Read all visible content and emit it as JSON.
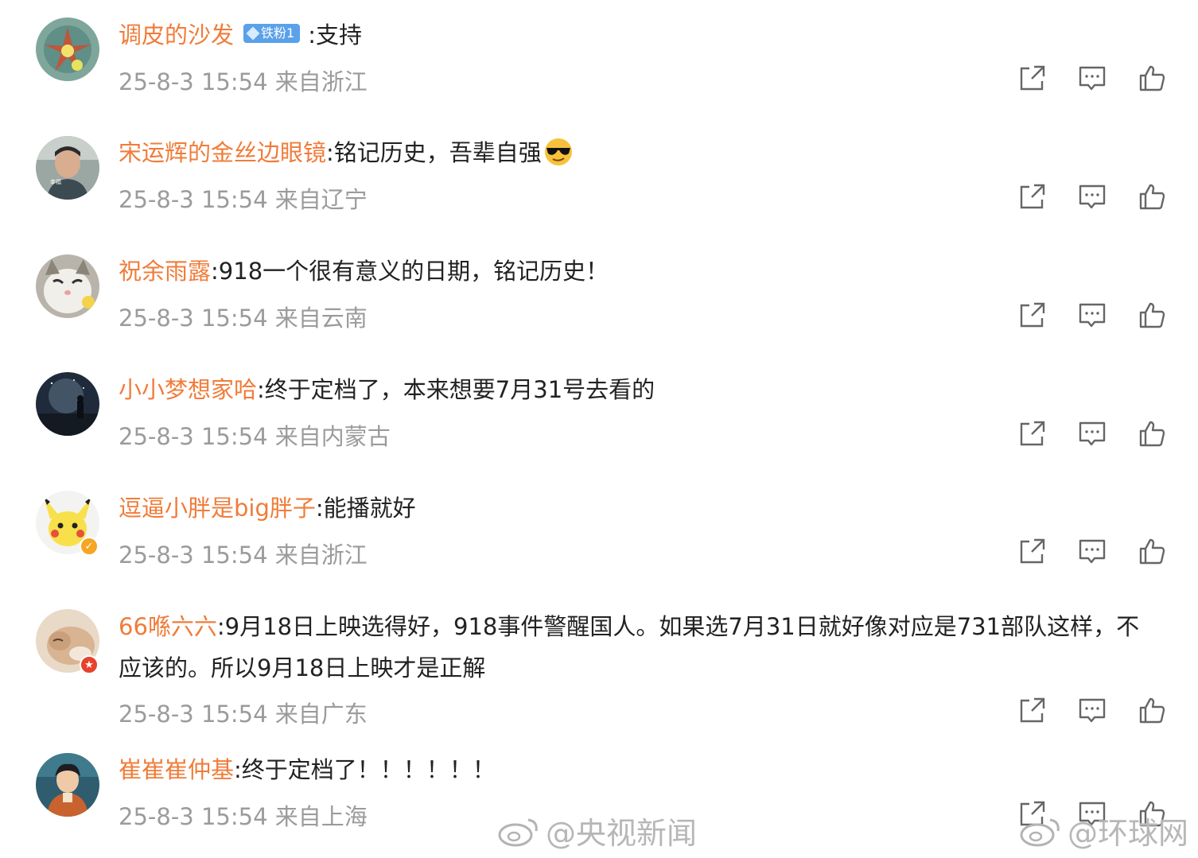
{
  "comments": [
    {
      "username": "调皮的沙发",
      "fan_badge": "铁粉1",
      "text": ":支持",
      "meta": "25-8-3 15:54 来自浙江",
      "avatar": "avatar-pinwheel"
    },
    {
      "username": "宋运辉的金丝边眼镜",
      "text": ":铭记历史，吾辈自强",
      "emoji": "sunglasses-emoji",
      "meta": "25-8-3 15:54 来自辽宁",
      "avatar": "avatar-man"
    },
    {
      "username": "祝余雨露",
      "text": ":918一个很有意义的日期，铭记历史！",
      "meta": "25-8-3 15:54 来自云南",
      "avatar": "avatar-cat"
    },
    {
      "username": "小小梦想家哈",
      "text": ":终于定档了，本来想要7月31号去看的",
      "meta": "25-8-3 15:54 来自内蒙古",
      "avatar": "avatar-night-sky"
    },
    {
      "username": "逗逼小胖是big胖子",
      "text": ":能播就好",
      "meta": "25-8-3 15:54 来自浙江",
      "avatar": "avatar-pikachu",
      "verified": "yellow"
    },
    {
      "username": "66喺六六",
      "text": ":9月18日上映选得好，918事件警醒国人。如果选7月31日就好像对应是731部队这样，不应该的。所以9月18日上映才是正解",
      "meta": "25-8-3 15:54 来自广东",
      "avatar": "avatar-sleeping-dog",
      "verified": "red"
    },
    {
      "username": "崔崔崔仲基",
      "text": ":终于定档了！！！！！！",
      "meta": "25-8-3 15:54 来自上海",
      "avatar": "avatar-anime-boy"
    }
  ],
  "actions": {
    "share_icon": "share-icon",
    "reply_icon": "comment-icon",
    "like_icon": "thumbs-up-icon"
  },
  "watermarks": {
    "left": "@央视新闻",
    "right": "@环球网"
  },
  "colors": {
    "username": "#f07c3a",
    "meta": "#9b9b9b",
    "text": "#222222",
    "fan_badge": "#5aa1ea"
  }
}
